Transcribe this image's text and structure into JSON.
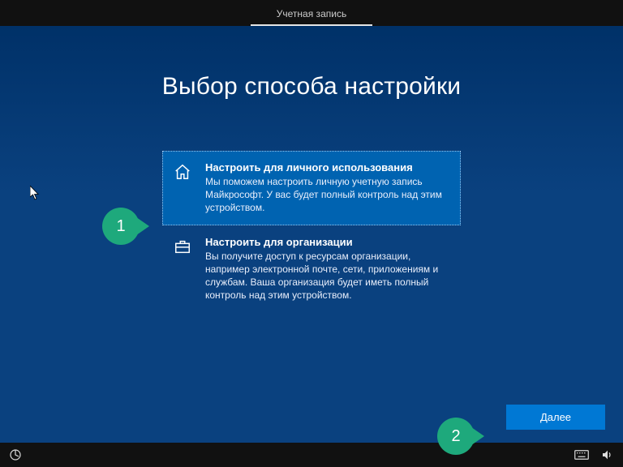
{
  "topbar": {
    "tab_account": "Учетная запись"
  },
  "page": {
    "title": "Выбор способа настройки"
  },
  "options": {
    "personal": {
      "title": "Настроить для личного использования",
      "desc": "Мы поможем настроить личную учетную запись Майкрософт. У вас будет полный контроль над этим устройством."
    },
    "org": {
      "title": "Настроить для организации",
      "desc": "Вы получите доступ к ресурсам организации, например электронной почте, сети, приложениям и службам. Ваша организация будет иметь полный контроль над этим устройством."
    }
  },
  "buttons": {
    "next": "Далее"
  },
  "callouts": {
    "one": "1",
    "two": "2"
  }
}
